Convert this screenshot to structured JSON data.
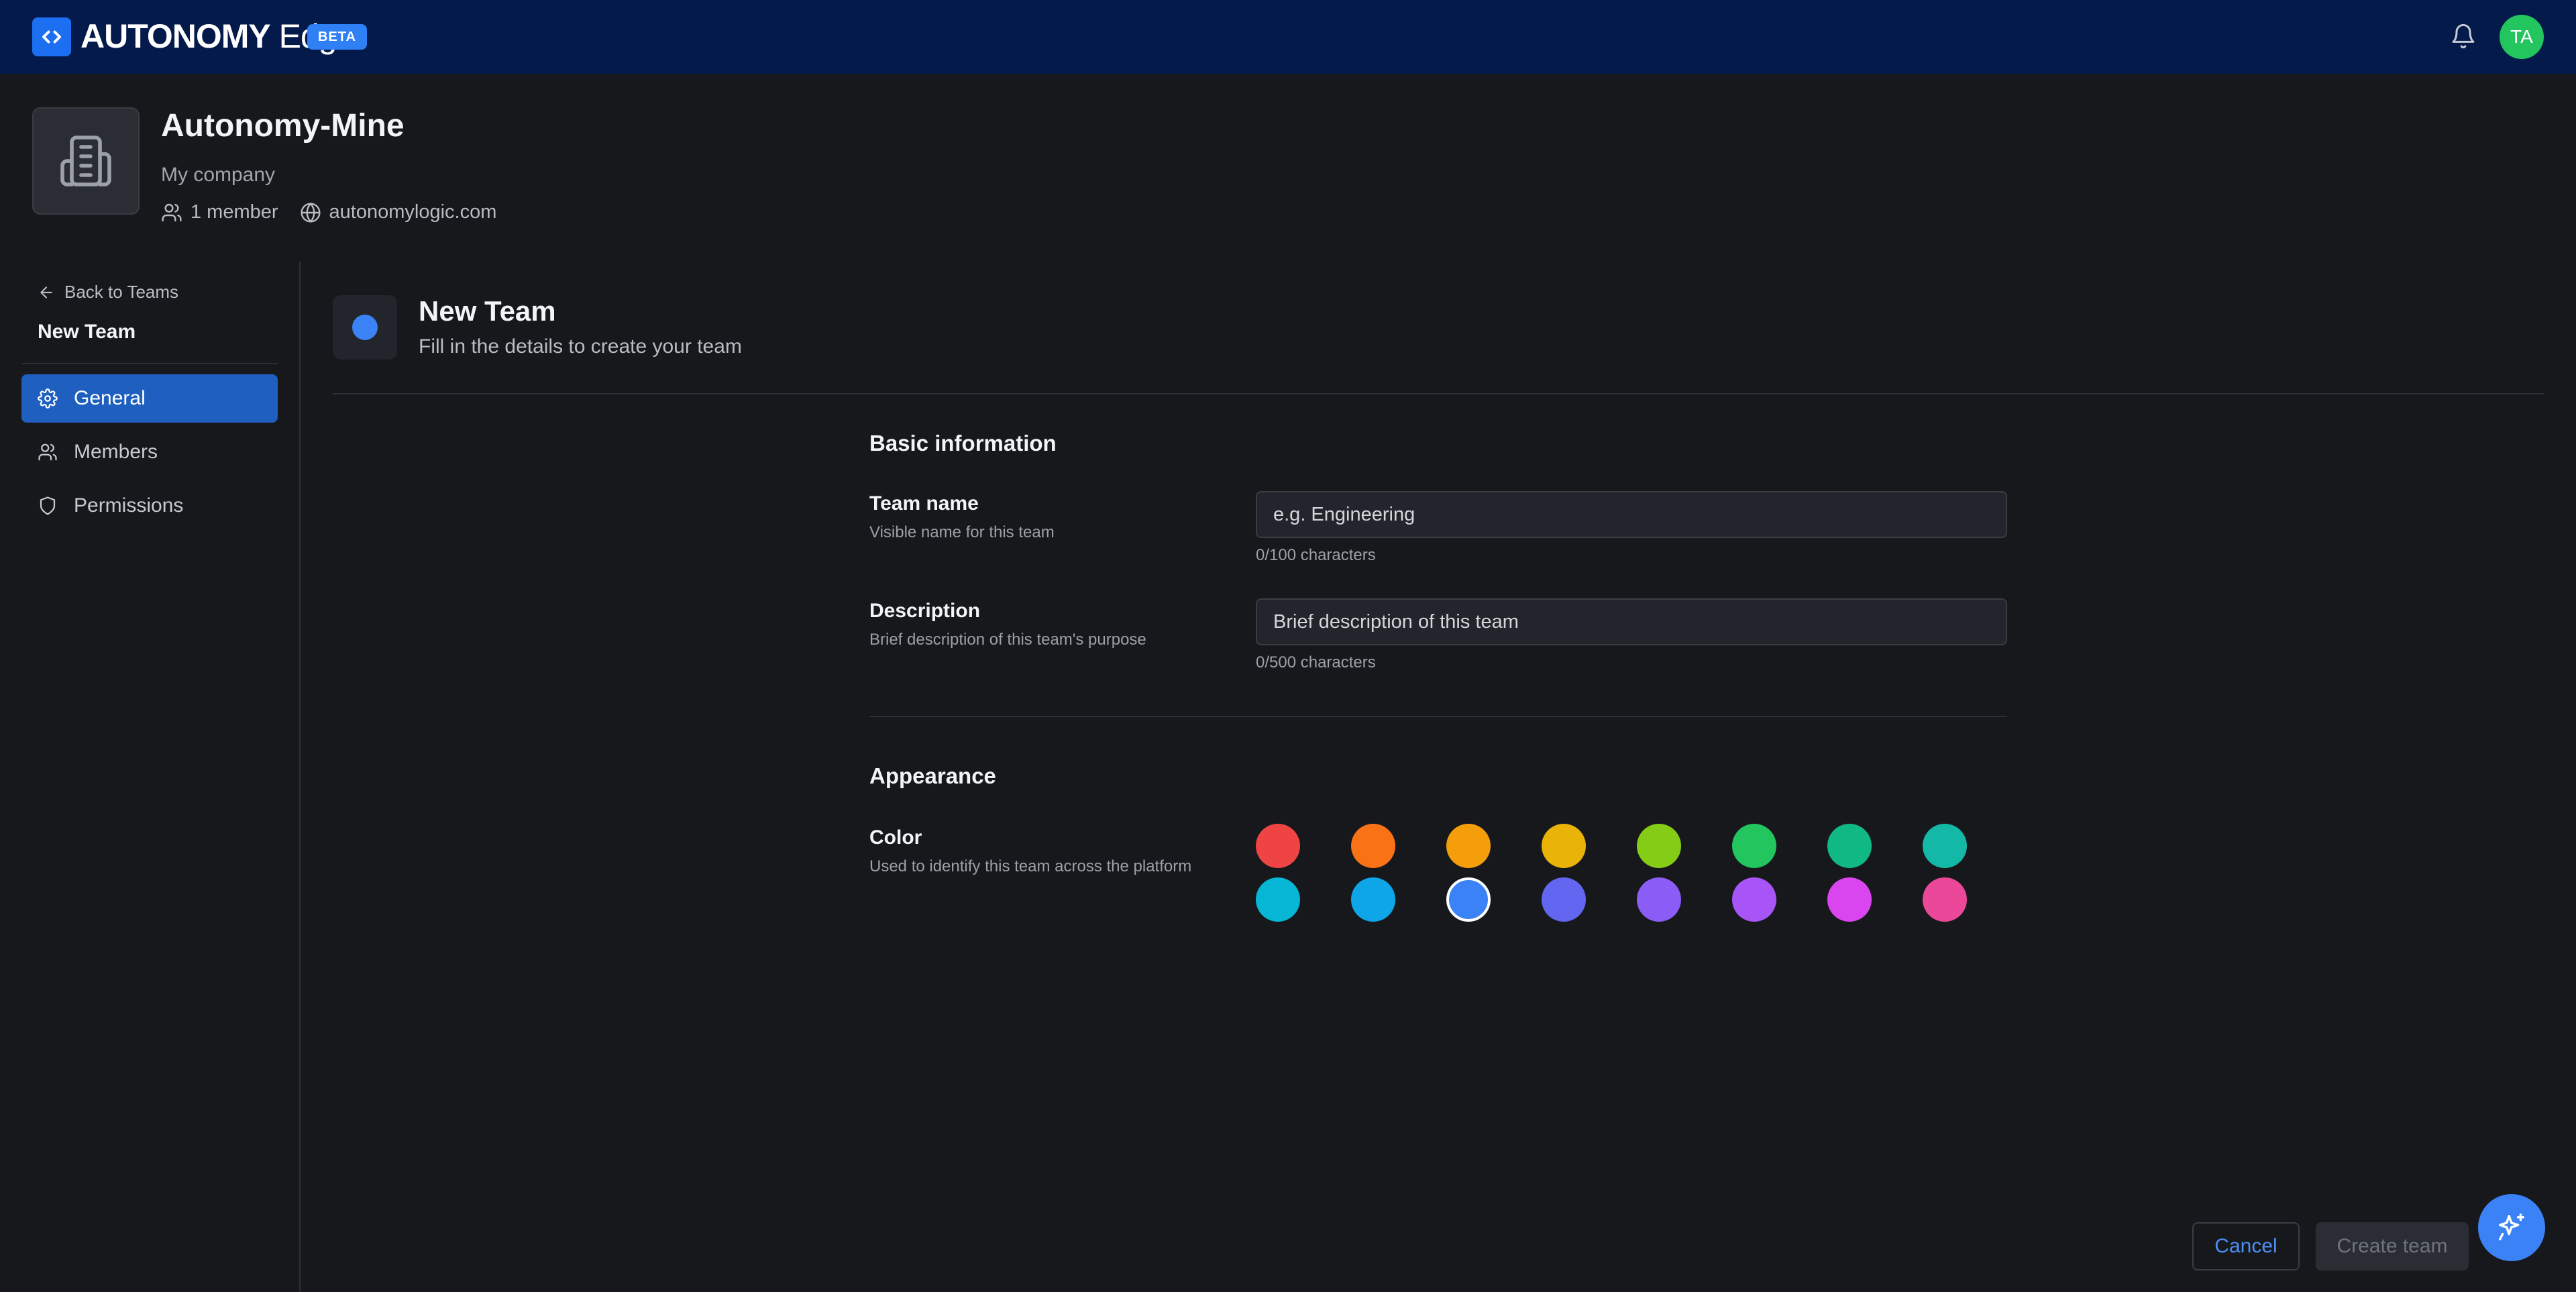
{
  "app": {
    "brand_bold": "AUTONOMY",
    "brand_light": " Edge",
    "beta_badge": "BETA",
    "avatar_initials": "TA"
  },
  "org": {
    "name": "Autonomy-Mine",
    "subtitle": "My company",
    "members": "1 member",
    "domain": "autonomylogic.com"
  },
  "sidebar": {
    "back_label": "Back to Teams",
    "title": "New Team",
    "items": [
      {
        "label": "General",
        "icon": "gear-icon",
        "active": true
      },
      {
        "label": "Members",
        "icon": "users-icon",
        "active": false
      },
      {
        "label": "Permissions",
        "icon": "shield-icon",
        "active": false
      }
    ]
  },
  "header": {
    "title": "New Team",
    "subtitle": "Fill in the details to create your team"
  },
  "form": {
    "basic_title": "Basic information",
    "team_name": {
      "label": "Team name",
      "help": "Visible name for this team",
      "placeholder": "e.g. Engineering",
      "value": "",
      "counter": "0/100 characters"
    },
    "description": {
      "label": "Description",
      "help": "Brief description of this team's purpose",
      "placeholder": "Brief description of this team",
      "value": "",
      "counter": "0/500 characters"
    },
    "appearance_title": "Appearance",
    "color": {
      "label": "Color",
      "help": "Used to identify this team across the platform",
      "selected": "#3b82f6",
      "options": [
        "#ef4444",
        "#f97316",
        "#f59e0b",
        "#eab308",
        "#84cc16",
        "#22c55e",
        "#10b981",
        "#14b8a6",
        "#06b6d4",
        "#0ea5e9",
        "#3b82f6",
        "#6366f1",
        "#8b5cf6",
        "#a855f7",
        "#d946ef",
        "#ec4899"
      ]
    }
  },
  "actions": {
    "cancel": "Cancel",
    "create": "Create team"
  },
  "colors": {
    "topbar": "#031a4a",
    "accent": "#1f5fbf",
    "avatar": "#22c55e"
  }
}
